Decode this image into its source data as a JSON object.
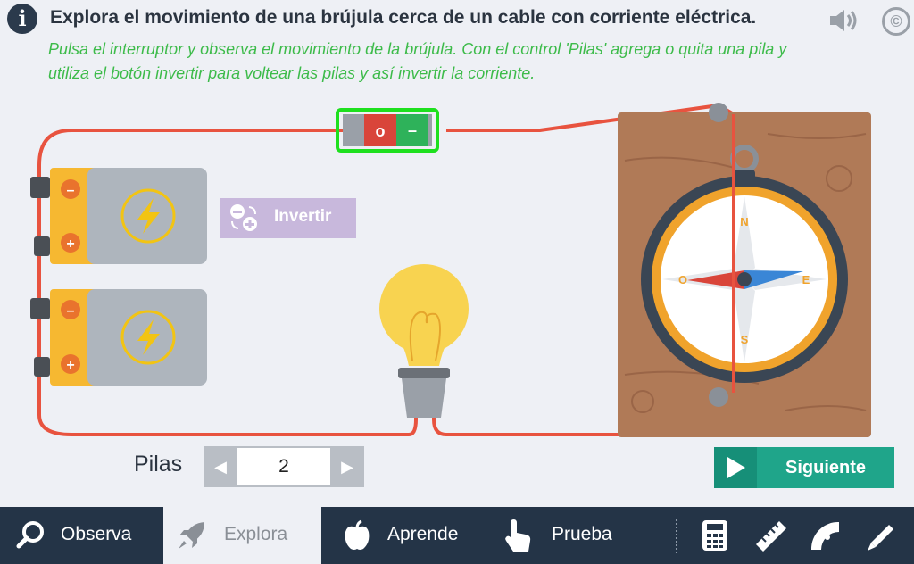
{
  "header": {
    "info_icon": "i",
    "title": "Explora el movimiento de una brújula cerca de un cable con corriente eléctrica.",
    "instructions": "Pulsa el interruptor y observa el movimiento de la brújula. Con el control 'Pilas' agrega o quita una pila y utiliza el botón invertir para voltear las pilas y así invertir la corriente.",
    "icons": [
      "sound-icon",
      "copyright-icon"
    ],
    "copyright_symbol": "©"
  },
  "switch": {
    "off_label": "o",
    "on_label": "–"
  },
  "invert_button": {
    "label": "Invertir"
  },
  "battery_terminals": {
    "negative": "–",
    "positive": "+"
  },
  "compass": {
    "north": "N",
    "south": "S",
    "east": "E",
    "west": "O"
  },
  "pilas": {
    "label": "Pilas",
    "value": "2",
    "dec_symbol": "◀",
    "inc_symbol": "▶"
  },
  "next_button": {
    "label": "Siguiente"
  },
  "nav": {
    "items": [
      {
        "label": "Observa",
        "icon": "search-icon"
      },
      {
        "label": "Explora",
        "icon": "rocket-icon",
        "active": true
      },
      {
        "label": "Aprende",
        "icon": "apple-icon"
      },
      {
        "label": "Prueba",
        "icon": "hand-pointer-icon"
      }
    ],
    "tools": [
      "calculator-icon",
      "ruler-icon",
      "protractor-icon",
      "pencil-icon"
    ]
  },
  "colors": {
    "accent_green": "#3dbb4a",
    "wire": "#e8533f",
    "nav_bg": "#243447",
    "next_button": "#1fa58a",
    "invert_button": "#c8b8dc"
  }
}
